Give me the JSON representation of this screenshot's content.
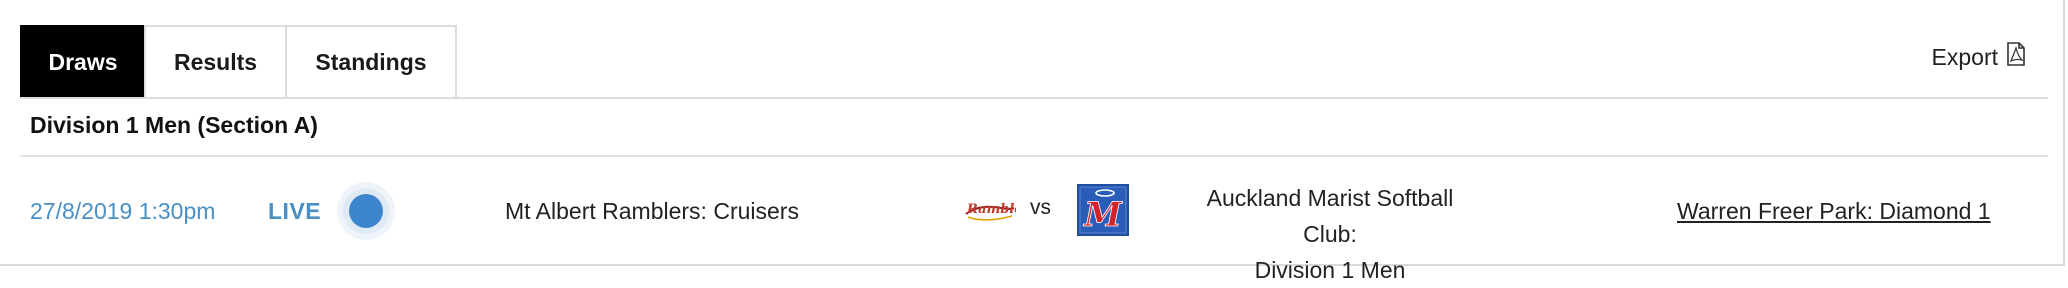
{
  "tabs": [
    {
      "label": "Draws",
      "active": true
    },
    {
      "label": "Results",
      "active": false
    },
    {
      "label": "Standings",
      "active": false
    }
  ],
  "export": {
    "label": "Export",
    "icon": "pdf-file-icon"
  },
  "section": {
    "title": "Division 1 Men (Section A)"
  },
  "match": {
    "datetime": "27/8/2019 1:30pm",
    "status": "LIVE",
    "status_icon": "live-indicator-dot",
    "home_team": "Mt Albert Ramblers: Cruisers",
    "home_logo": "Ramblers",
    "vs": "vs",
    "away_logo": "M",
    "away_team_line1": "Auckland Marist Softball Club:",
    "away_team_line2": "Division 1 Men",
    "venue": "Warren Freer Park: Diamond 1"
  },
  "colors": {
    "accent": "#4a8fc4",
    "live_dot": "#3d86cc",
    "active_tab_bg": "#000000",
    "away_logo_bg": "#1f4fa3",
    "away_logo_letter": "#d2232a",
    "home_logo": "#c0392b"
  }
}
